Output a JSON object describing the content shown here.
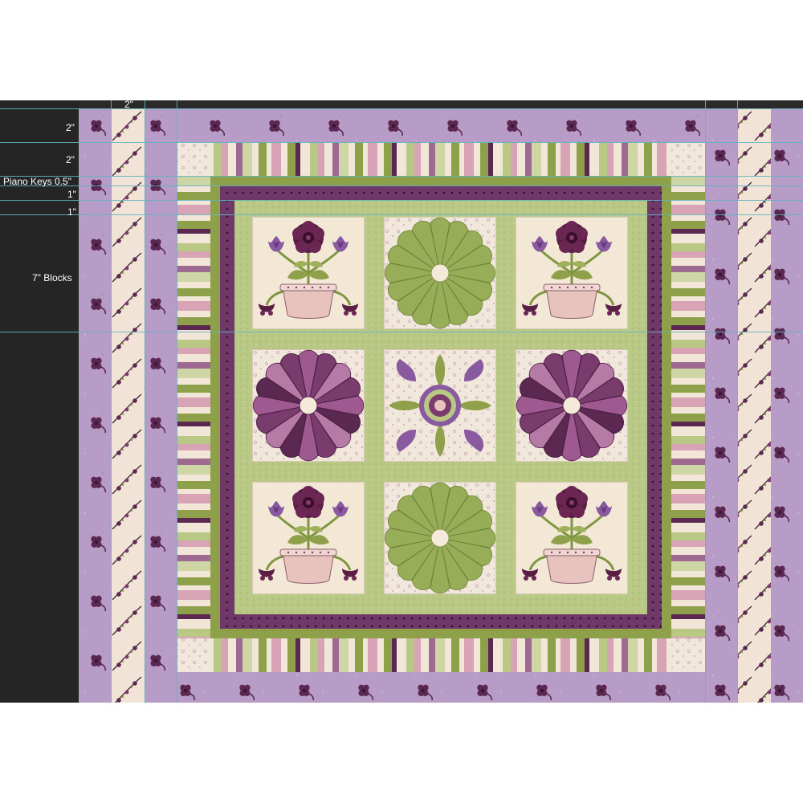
{
  "measurements": {
    "top_width_label": "2\"",
    "rows": [
      {
        "label": "2\""
      },
      {
        "label": "2\""
      },
      {
        "label": "Piano Keys 0.5\""
      },
      {
        "label": "1\""
      },
      {
        "label": "1\""
      },
      {
        "label": "7\" Blocks"
      }
    ]
  },
  "colors": {
    "lavender": "#b79cc8",
    "lavender_dark": "#a88abd",
    "plum": "#5a2850",
    "plum_dark": "#3d1538",
    "green": "#8ea04a",
    "green_light": "#b9c884",
    "green_pale": "#cfd6a6",
    "cream": "#f2e6d8",
    "pink": "#d8a3b5",
    "mauve": "#9e6a92",
    "pot": "#e8c3bd",
    "guide": "#5fb4c4"
  },
  "blocks": [
    {
      "type": "flower-pot",
      "dresden_color": ""
    },
    {
      "type": "dresden",
      "dresden_color": "green"
    },
    {
      "type": "flower-pot",
      "dresden_color": ""
    },
    {
      "type": "dresden",
      "dresden_color": "purple"
    },
    {
      "type": "medallion",
      "dresden_color": ""
    },
    {
      "type": "dresden",
      "dresden_color": "purple"
    },
    {
      "type": "flower-pot",
      "dresden_color": ""
    },
    {
      "type": "dresden",
      "dresden_color": "green"
    },
    {
      "type": "flower-pot",
      "dresden_color": ""
    }
  ]
}
